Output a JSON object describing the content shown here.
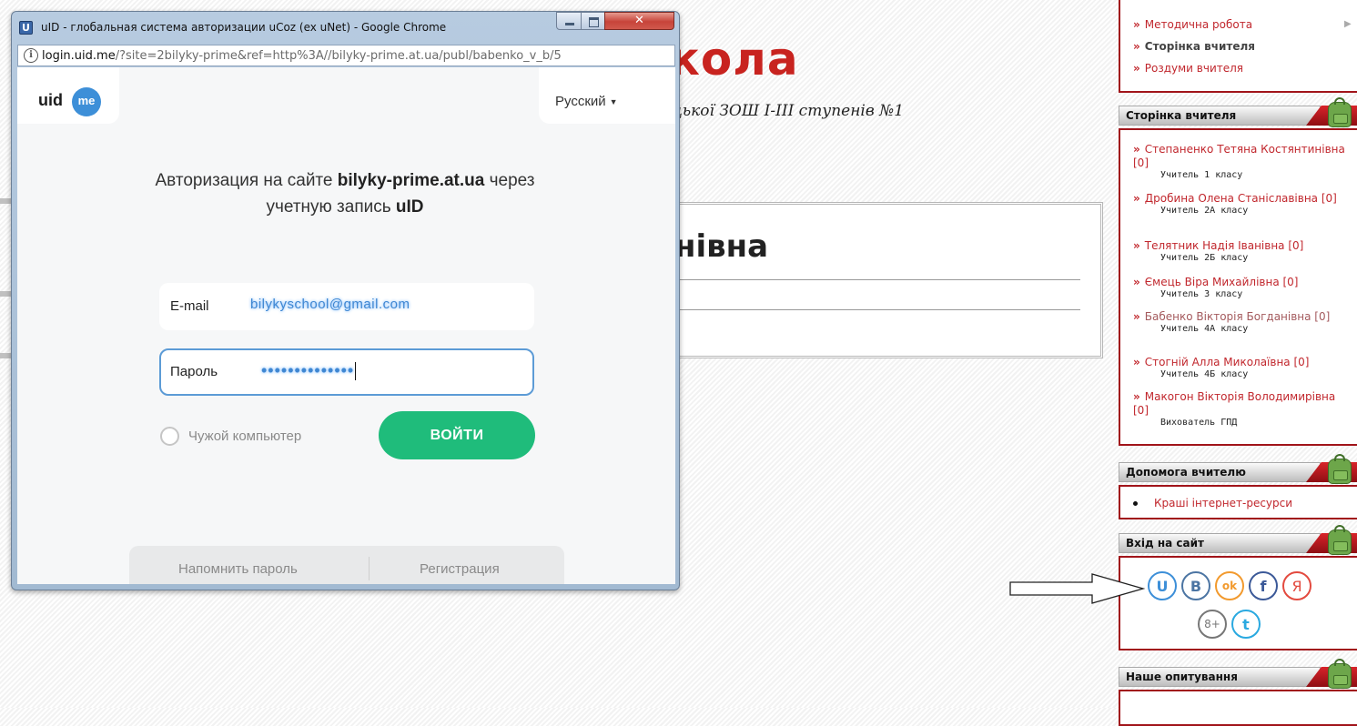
{
  "site": {
    "title_fragment": "кола",
    "subtitle_fragment": "цької ЗОШ І-ІІІ ступенів №1",
    "content_heading_fragment": "нівна"
  },
  "sidebar": {
    "menu": [
      {
        "label": "Методична робота",
        "style": "link"
      },
      {
        "label": "Сторінка вчителя",
        "style": "bold"
      },
      {
        "label": "Роздуми вчителя",
        "style": "link"
      }
    ],
    "teachers_block": {
      "title": "Сторінка вчителя",
      "items": [
        {
          "name": "Степаненко Тетяна Костянтинівна [0]",
          "role": "Учитель 1 класу"
        },
        {
          "name": "Дробина Олена Станіславівна [0]",
          "role": "Учитель 2А класу"
        },
        {
          "name": "Телятник Надія Іванівна [0]",
          "role": "Учитель 2Б класу"
        },
        {
          "name": "Ємець Віра Михайлівна [0]",
          "role": "Учитель 3 класу"
        },
        {
          "name": "Бабенко Вікторія Богданівна [0]",
          "role": "Учитель 4А класу"
        },
        {
          "name": "Стогній Алла Миколаївна [0]",
          "role": "Учитель 4Б класу"
        },
        {
          "name": "Макогон Вікторія Володимирівна [0]",
          "role": "Вихователь ГПД"
        }
      ]
    },
    "help_block": {
      "title": "Допомога вчителю",
      "items": [
        "Краші інтернет-ресурси"
      ]
    },
    "login_block": {
      "title": "Вхід на сайт",
      "socials": [
        {
          "icon": "U",
          "name": "uid-icon",
          "color": "#3d8fd8"
        },
        {
          "icon": "B",
          "name": "vkontakte-icon",
          "color": "#4c75a3"
        },
        {
          "icon": "ok",
          "name": "odnoklassniki-icon",
          "color": "#f29a2e"
        },
        {
          "icon": "f",
          "name": "facebook-icon",
          "color": "#3b5998"
        },
        {
          "icon": "Я",
          "name": "yandex-icon",
          "color": "#e34a3f"
        },
        {
          "icon": "8+",
          "name": "google-plus-icon",
          "color": "#777777"
        },
        {
          "icon": "t",
          "name": "twitter-icon",
          "color": "#2aa9e0"
        }
      ]
    },
    "poll_block": {
      "title": "Наше опитування"
    }
  },
  "popup": {
    "window_title": "uID - глобальная система авторизации uCoz (ex uNet) - Google Chrome",
    "window_icon": "U",
    "url_host": "login.uid.me",
    "url_path": "/?site=2bilyky-prime&ref=http%3A//bilyky-prime.at.ua/publ/babenko_v_b/5",
    "logo_uid": "uid",
    "logo_me": "me",
    "language": "Русский",
    "auth_text_1": "Авторизация на сайте ",
    "auth_site": "bilyky-prime.at.ua",
    "auth_text_2": " через учетную запись ",
    "auth_account": "uID",
    "email_label": "E-mail",
    "email_value": "bilykyschool@gmail.com",
    "password_label": "Пароль",
    "password_value": "••••••••••••••",
    "remember_label": "Чужой компьютер",
    "login_button": "ВОЙТИ",
    "forgot_link": "Напомнить пароль",
    "register_link": "Регистрация"
  },
  "colors": {
    "accent_green": "#1fbc7b",
    "site_red": "#c8231f",
    "uid_blue": "#3d8fd8"
  }
}
